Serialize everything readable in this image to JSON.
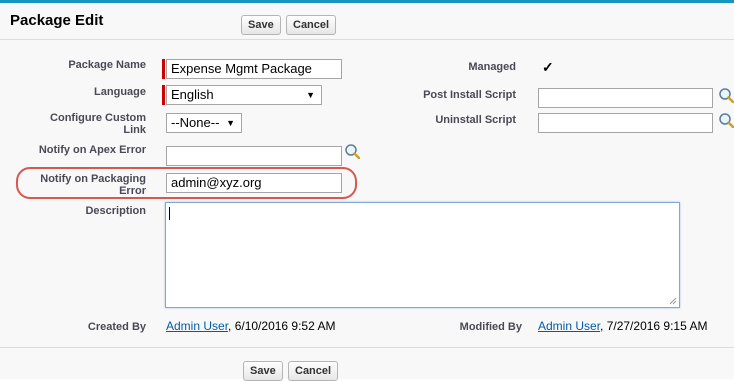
{
  "header": {
    "title": "Package Edit",
    "save_label": "Save",
    "cancel_label": "Cancel"
  },
  "footer": {
    "save_label": "Save",
    "cancel_label": "Cancel"
  },
  "fields": {
    "package_name": {
      "label": "Package Name",
      "value": "Expense Mgmt Package"
    },
    "language": {
      "label": "Language",
      "value": "English"
    },
    "configure_custom_link": {
      "label_line1": "Configure Custom",
      "label_line2": "Link",
      "value": "--None--"
    },
    "notify_apex_error": {
      "label": "Notify on Apex Error",
      "value": ""
    },
    "notify_packaging_error": {
      "label_line1": "Notify on Packaging",
      "label_line2": "Error",
      "value": "admin@xyz.org"
    },
    "description": {
      "label": "Description",
      "value": ""
    },
    "managed": {
      "label": "Managed",
      "value": "✓"
    },
    "post_install_script": {
      "label": "Post Install Script",
      "value": ""
    },
    "uninstall_script": {
      "label": "Uninstall Script",
      "value": ""
    },
    "created_by": {
      "label": "Created By",
      "user": "Admin User",
      "date": ", 6/10/2016 9:52 AM"
    },
    "modified_by": {
      "label": "Modified By",
      "user": "Admin User",
      "date": ", 7/27/2016 9:15 AM"
    }
  },
  "colors": {
    "accent": "#1797c0",
    "required": "#cc0000",
    "highlight": "#d9574f",
    "link": "#015ba7"
  },
  "icons": {
    "lookup": "lookup-magnifier-icon",
    "dropdown": "chevron-down-icon"
  }
}
